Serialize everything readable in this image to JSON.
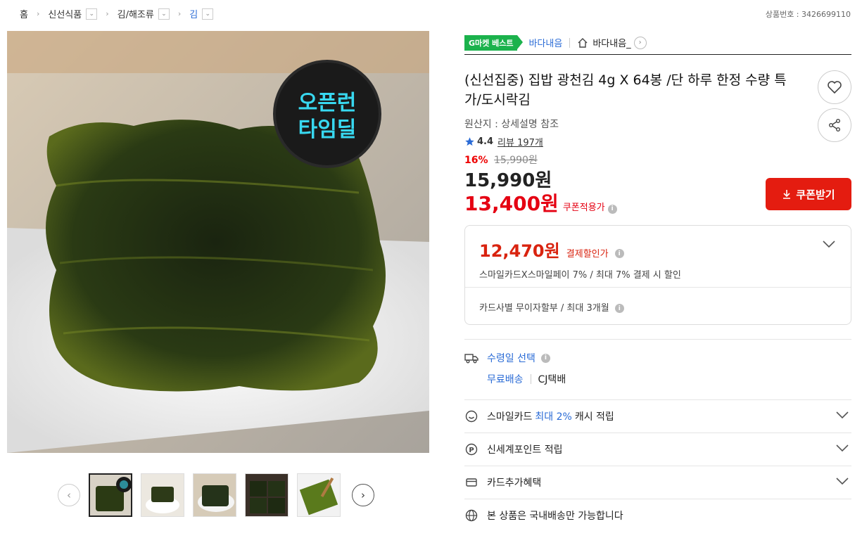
{
  "breadcrumb": {
    "home": "홈",
    "items": [
      {
        "label": "신선식품"
      },
      {
        "label": "김/해조류"
      },
      {
        "label": "김"
      }
    ]
  },
  "product_no": "상품번호 : 3426699110",
  "image": {
    "badge_line1": "오픈런",
    "badge_line2": "타임딜"
  },
  "thumbnails": {
    "count": 5,
    "selected": 1
  },
  "store": {
    "badge": "G마켓 베스트",
    "name": "바다내음",
    "shop_name": "바다내음_"
  },
  "product": {
    "title": "(신선집중) 집밥 광천김 4g X 64봉 /단 하루 한정 수량 특가/도시락김",
    "origin": "원산지 : 상세설명 참조",
    "rating": "4.4",
    "review_label": "리뷰 197개",
    "discount_rate": "16%",
    "original_price": "15,990원",
    "price": "15,990원",
    "coupon_price": "13,400원",
    "coupon_applied_label": "쿠폰적용가",
    "coupon_button": "쿠폰받기"
  },
  "benefit": {
    "pay_price": "12,470원",
    "pay_label": "결제할인가",
    "pay_desc": "스마일카드X스마일페이 7% / 최대 7% 결제 시 할인",
    "installment": "카드사별 무이자할부 / 최대 3개월"
  },
  "delivery": {
    "label": "수령일 선택",
    "free": "무료배송",
    "courier": "CJ택배"
  },
  "rows": {
    "smile_prefix": "스마일카드",
    "smile_highlight": "최대 2%",
    "smile_suffix": "캐시 적립",
    "shinsegae": "신세계포인트 적립",
    "card_benefit": "카드추가혜택",
    "domestic": "본 상품은 국내배송만 가능합니다"
  },
  "colors": {
    "accent_red": "#e41c10",
    "link_blue": "#2a6bd6",
    "best_green": "#1bb24c"
  }
}
